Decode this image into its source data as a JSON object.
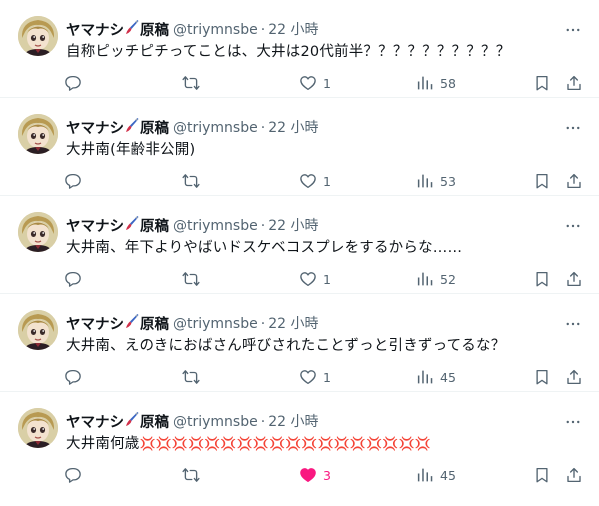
{
  "tweets": [
    {
      "author": "ヤマナシ",
      "author_suffix": "原稿",
      "handle": "@triymnsbe",
      "time": "22 小時",
      "text": "自称ピッチピチってことは、大井は20代前半？？？？？？？？？？",
      "likes": "1",
      "views": "58",
      "liked": false
    },
    {
      "author": "ヤマナシ",
      "author_suffix": "原稿",
      "handle": "@triymnsbe",
      "time": "22 小時",
      "text": "大井南(年齢非公開)",
      "likes": "1",
      "views": "53",
      "liked": false
    },
    {
      "author": "ヤマナシ",
      "author_suffix": "原稿",
      "handle": "@triymnsbe",
      "time": "22 小時",
      "text": "大井南、年下よりやばいドスケベコスプレをするからな……",
      "likes": "1",
      "views": "52",
      "liked": false
    },
    {
      "author": "ヤマナシ",
      "author_suffix": "原稿",
      "handle": "@triymnsbe",
      "time": "22 小時",
      "text": "大井南、えのきにおばさん呼びされたことずっと引きずってるな？",
      "likes": "1",
      "views": "45",
      "liked": false
    },
    {
      "author": "ヤマナシ",
      "author_suffix": "原稿",
      "handle": "@triymnsbe",
      "time": "22 小時",
      "text": "大井南何歳",
      "text_emojis": "💢💢💢💢💢💢💢💢💢💢💢💢💢💢💢💢💢💢",
      "likes": "3",
      "views": "45",
      "liked": true
    }
  ],
  "icons": {
    "reply": "reply-icon",
    "retweet": "retweet-icon",
    "like": "like-icon",
    "views": "views-icon",
    "bookmark": "bookmark-icon",
    "share": "share-icon",
    "more": "more-icon",
    "brush": "paintbrush-emoji-icon"
  },
  "colors": {
    "text": "#0f1419",
    "secondary": "#536471",
    "divider": "#eff3f4",
    "like_active": "#f91880"
  }
}
